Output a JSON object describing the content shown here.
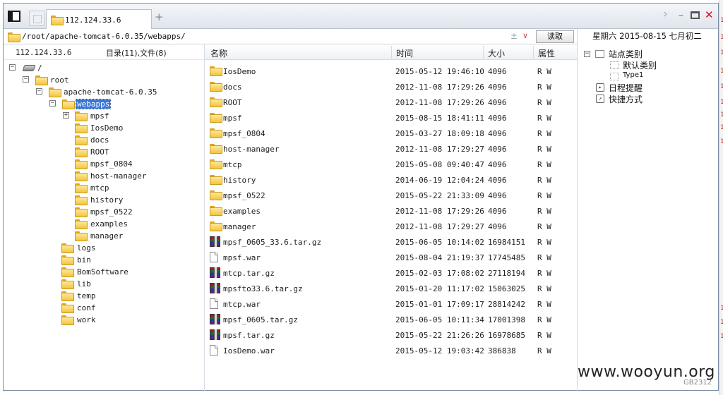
{
  "tab": {
    "label": "112.124.33.6"
  },
  "path": {
    "value": "/root/apache-tomcat-6.0.35/webapps/",
    "plusminus": "±",
    "dropdown": "∨"
  },
  "read_button": "读取",
  "date_line": "星期六 2015-08-15 七月初二",
  "left_header": {
    "server": "112.124.33.6",
    "dir_count": "目录(11),文件(8)"
  },
  "tree": [
    {
      "label": "/",
      "icon": "drive-icon",
      "toggle": "−"
    },
    {
      "label": "root",
      "icon": "folder-icon",
      "toggle": "−"
    },
    {
      "label": "apache-tomcat-6.0.35",
      "icon": "folder-icon",
      "toggle": "−"
    },
    {
      "label": "webapps",
      "icon": "folder-icon",
      "toggle": "−",
      "selected": true
    },
    {
      "label": "mpsf",
      "icon": "folder-icon",
      "toggle": "+"
    },
    {
      "label": "IosDemo",
      "icon": "folder-icon"
    },
    {
      "label": "docs",
      "icon": "folder-icon"
    },
    {
      "label": "ROOT",
      "icon": "folder-icon"
    },
    {
      "label": "mpsf_0804",
      "icon": "folder-icon"
    },
    {
      "label": "host-manager",
      "icon": "folder-icon"
    },
    {
      "label": "mtcp",
      "icon": "folder-icon"
    },
    {
      "label": "history",
      "icon": "folder-icon"
    },
    {
      "label": "mpsf_0522",
      "icon": "folder-icon"
    },
    {
      "label": "examples",
      "icon": "folder-icon"
    },
    {
      "label": "manager",
      "icon": "folder-icon"
    },
    {
      "label": "logs",
      "icon": "folder-icon"
    },
    {
      "label": "bin",
      "icon": "folder-icon"
    },
    {
      "label": "BomSoftware",
      "icon": "folder-icon"
    },
    {
      "label": "lib",
      "icon": "folder-icon"
    },
    {
      "label": "temp",
      "icon": "folder-icon"
    },
    {
      "label": "conf",
      "icon": "folder-icon"
    },
    {
      "label": "work",
      "icon": "folder-icon"
    }
  ],
  "file_columns": {
    "name": "名称",
    "time": "时间",
    "size": "大小",
    "attr": "属性"
  },
  "files": [
    {
      "name": "IosDemo",
      "time": "2015-05-12 19:46:10",
      "size": "4096",
      "attr": "R W",
      "icon": "folder-icon"
    },
    {
      "name": "docs",
      "time": "2012-11-08 17:29:26",
      "size": "4096",
      "attr": "R W",
      "icon": "folder-icon"
    },
    {
      "name": "ROOT",
      "time": "2012-11-08 17:29:26",
      "size": "4096",
      "attr": "R W",
      "icon": "folder-icon"
    },
    {
      "name": "mpsf",
      "time": "2015-08-15 18:41:11",
      "size": "4096",
      "attr": "R W",
      "icon": "folder-icon"
    },
    {
      "name": "mpsf_0804",
      "time": "2015-03-27 18:09:18",
      "size": "4096",
      "attr": "R W",
      "icon": "folder-icon"
    },
    {
      "name": "host-manager",
      "time": "2012-11-08 17:29:27",
      "size": "4096",
      "attr": "R W",
      "icon": "folder-icon"
    },
    {
      "name": "mtcp",
      "time": "2015-05-08 09:40:47",
      "size": "4096",
      "attr": "R W",
      "icon": "folder-icon"
    },
    {
      "name": "history",
      "time": "2014-06-19 12:04:24",
      "size": "4096",
      "attr": "R W",
      "icon": "folder-icon"
    },
    {
      "name": "mpsf_0522",
      "time": "2015-05-22 21:33:09",
      "size": "4096",
      "attr": "R W",
      "icon": "folder-icon"
    },
    {
      "name": "examples",
      "time": "2012-11-08 17:29:26",
      "size": "4096",
      "attr": "R W",
      "icon": "folder-icon"
    },
    {
      "name": "manager",
      "time": "2012-11-08 17:29:27",
      "size": "4096",
      "attr": "R W",
      "icon": "folder-icon"
    },
    {
      "name": "mpsf_0605_33.6.tar.gz",
      "time": "2015-06-05 10:14:02",
      "size": "16984151",
      "attr": "R W",
      "icon": "archive-icon"
    },
    {
      "name": "mpsf.war",
      "time": "2015-08-04 21:19:37",
      "size": "17745485",
      "attr": "R W",
      "icon": "document-icon"
    },
    {
      "name": "mtcp.tar.gz",
      "time": "2015-02-03 17:08:02",
      "size": "27118194",
      "attr": "R W",
      "icon": "archive-icon"
    },
    {
      "name": "mpsfto33.6.tar.gz",
      "time": "2015-01-20 11:17:02",
      "size": "15063025",
      "attr": "R W",
      "icon": "archive-icon"
    },
    {
      "name": "mtcp.war",
      "time": "2015-01-01 17:09:17",
      "size": "28814242",
      "attr": "R W",
      "icon": "document-icon"
    },
    {
      "name": "mpsf_0605.tar.gz",
      "time": "2015-06-05 10:11:34",
      "size": "17001398",
      "attr": "R W",
      "icon": "archive-icon"
    },
    {
      "name": "mpsf.tar.gz",
      "time": "2015-05-22 21:26:26",
      "size": "16978685",
      "attr": "R W",
      "icon": "archive-icon"
    },
    {
      "name": "IosDemo.war",
      "time": "2015-05-12 19:03:42",
      "size": "386838",
      "attr": "R W",
      "icon": "document-icon"
    }
  ],
  "right_panel": {
    "site_category": "站点类别",
    "default_category": "默认类别",
    "type1": "Type1",
    "schedule": "日程提醒",
    "shortcuts": "快捷方式"
  },
  "watermark": "www.wooyun.org",
  "watermark_small": "GB2312",
  "right_edge_marks": [
    "1",
    "1",
    "1",
    "1",
    "1",
    "1",
    "1",
    "1",
    "1",
    "1",
    "1",
    "1"
  ]
}
